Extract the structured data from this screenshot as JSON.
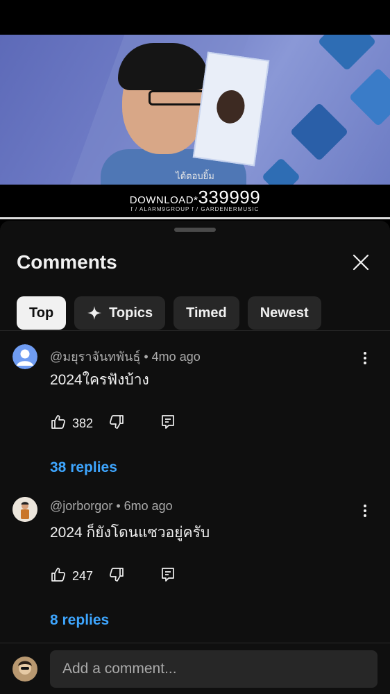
{
  "video": {
    "subtitle": "ได้ตอบยิ้ม",
    "download_word": "DOWNLOAD*",
    "download_code": "339999",
    "download_social": "f / ALARM9GROUP   f / GARDENERMUSIC",
    "progress_fraction": 1.0
  },
  "panel": {
    "title": "Comments",
    "close_icon": "close-icon"
  },
  "chips": [
    {
      "label": "Top",
      "active": true
    },
    {
      "label": "Topics",
      "icon": "sparkle-icon"
    },
    {
      "label": "Timed"
    },
    {
      "label": "Newest"
    }
  ],
  "comments": [
    {
      "author": "@มยุราจันทพันธุ์",
      "time": "4mo ago",
      "text": "2024ใครฟังบ้าง",
      "likes": "382",
      "replies": "38 replies",
      "avatar_color": "#6f9cf2"
    },
    {
      "author": "@jorborgor",
      "time": "6mo ago",
      "text": "2024 ก็ยังโดนแซวอยู่ครับ",
      "likes": "247",
      "replies": "8 replies",
      "avatar_color": "#e9e4dc"
    }
  ],
  "composer": {
    "placeholder": "Add a comment..."
  },
  "colors": {
    "background": "#0f0f0f",
    "chip": "#272727",
    "accent_link": "#3ea6ff",
    "muted_text": "#aaaaaa"
  }
}
